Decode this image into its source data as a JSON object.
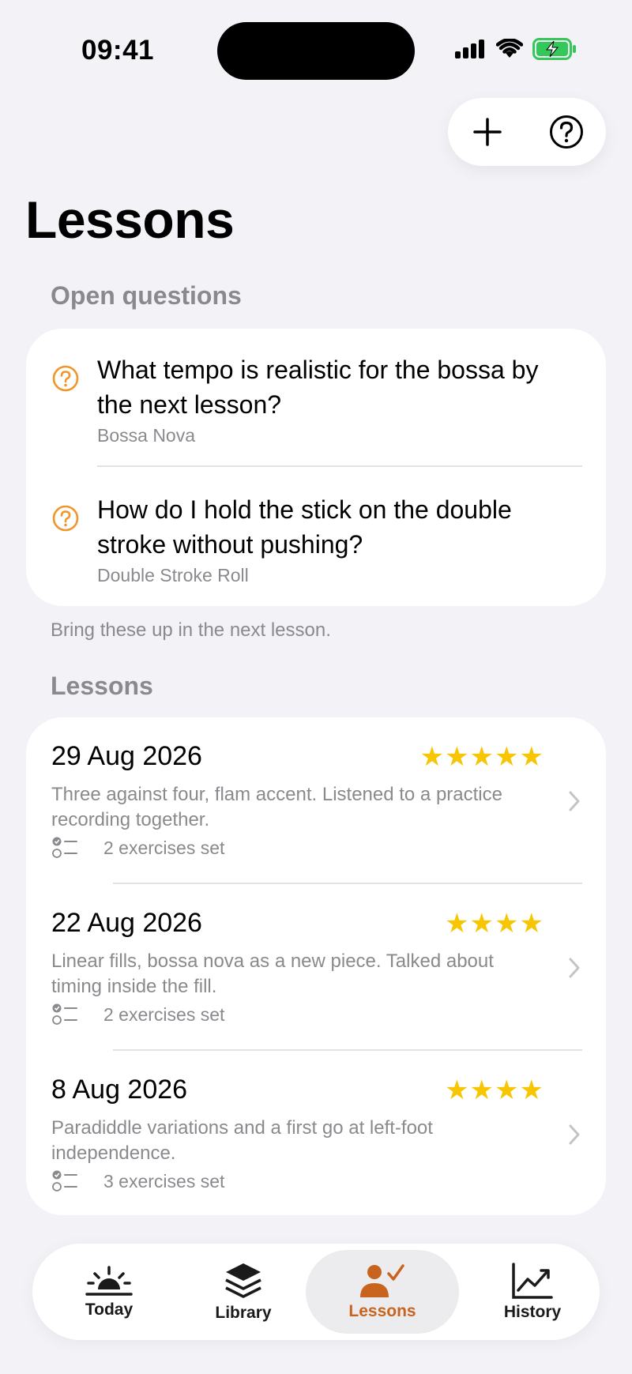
{
  "status": {
    "time": "09:41"
  },
  "header": {
    "title": "Lessons",
    "add_icon": "plus-icon",
    "help_icon": "question-circle-icon"
  },
  "open_questions": {
    "header": "Open questions",
    "items": [
      {
        "text": "What tempo is realistic for the bossa by the next lesson?",
        "line1": "What tempo is realistic for the bossa by",
        "line2": "the next lesson?",
        "piece": "Bossa Nova"
      },
      {
        "text": "How do I hold the stick on the double stroke without pushing?",
        "line1": "How do I hold the stick on the double",
        "line2": "stroke without pushing?",
        "piece": "Double Stroke Roll"
      }
    ],
    "footer": "Bring these up in the next lesson."
  },
  "lessons": {
    "header": "Lessons",
    "items": [
      {
        "date": "29 Aug 2026",
        "rating": 5,
        "stars": "★★★★★",
        "line1": "Three against four, flam accent. Listened to a practice",
        "line2": "recording together.",
        "exercises": "2 exercises set"
      },
      {
        "date": "22 Aug 2026",
        "rating": 4,
        "stars": "★★★★",
        "line1": "Linear fills, bossa nova as a new piece. Talked about",
        "line2": "timing inside the fill.",
        "exercises": "2 exercises set"
      },
      {
        "date": "8 Aug 2026",
        "rating": 4,
        "stars": "★★★★",
        "line1": "Paradiddle variations and a first go at left-foot",
        "line2": "independence.",
        "exercises": "3 exercises set"
      }
    ]
  },
  "tabs": [
    {
      "label": "Today",
      "icon": "sunrise-icon"
    },
    {
      "label": "Library",
      "icon": "stack-icon"
    },
    {
      "label": "Lessons",
      "icon": "person-check-icon",
      "active": true
    },
    {
      "label": "History",
      "icon": "chart-up-icon"
    }
  ],
  "colors": {
    "accent": "#c8641e",
    "question": "#f0962a",
    "star": "#f7c600",
    "secondary": "#8a8a8e",
    "background": "#f2f2f7"
  }
}
